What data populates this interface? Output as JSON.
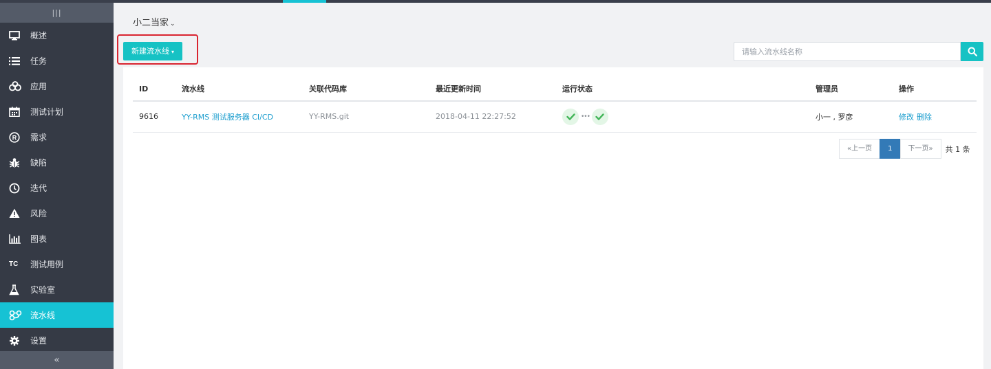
{
  "colors": {
    "accent": "#16c2d4",
    "sidebar_bg": "#353a45",
    "link": "#1a9dce",
    "highlight": "#d9242f",
    "status_ok": "#44b65a"
  },
  "sidebar": {
    "head_icon": "|||",
    "items": [
      {
        "label": "概述",
        "icon": "monitor-icon"
      },
      {
        "label": "任务",
        "icon": "task-list-icon"
      },
      {
        "label": "应用",
        "icon": "apps-icon"
      },
      {
        "label": "测试计划",
        "icon": "calendar-icon"
      },
      {
        "label": "需求",
        "icon": "registered-icon"
      },
      {
        "label": "缺陷",
        "icon": "bug-icon"
      },
      {
        "label": "迭代",
        "icon": "clock-icon"
      },
      {
        "label": "风险",
        "icon": "warning-icon"
      },
      {
        "label": "图表",
        "icon": "bar-chart-icon"
      },
      {
        "label": "测试用例",
        "icon": "tc-icon",
        "icon_text": "TC"
      },
      {
        "label": "实验室",
        "icon": "flask-icon"
      },
      {
        "label": "流水线",
        "icon": "pipeline-icon",
        "active": true
      },
      {
        "label": "设置",
        "icon": "gear-icon"
      }
    ],
    "collapse_label": "«"
  },
  "header": {
    "project_name": "小二当家",
    "project_caret": "⌄"
  },
  "toolbar": {
    "new_pipeline_label": "新建流水线",
    "new_pipeline_caret": "▾"
  },
  "search": {
    "placeholder": "请输入流水线名称",
    "value": ""
  },
  "table": {
    "columns": [
      "ID",
      "流水线",
      "关联代码库",
      "最近更新时间",
      "运行状态",
      "管理员",
      "操作"
    ],
    "rows": [
      {
        "id": "9616",
        "name": "YY-RMS 测试服务器 CI/CD",
        "repo": "YY-RMS.git",
        "updated": "2018-04-11 22:27:52",
        "status_separator": "•••",
        "admins": "小一 , 罗彦",
        "actions": [
          "修改",
          "删除"
        ]
      }
    ]
  },
  "pagination": {
    "prev_label": "«上一页",
    "current_page": "1",
    "next_label": "下一页»",
    "total_label": "共 1 条"
  }
}
